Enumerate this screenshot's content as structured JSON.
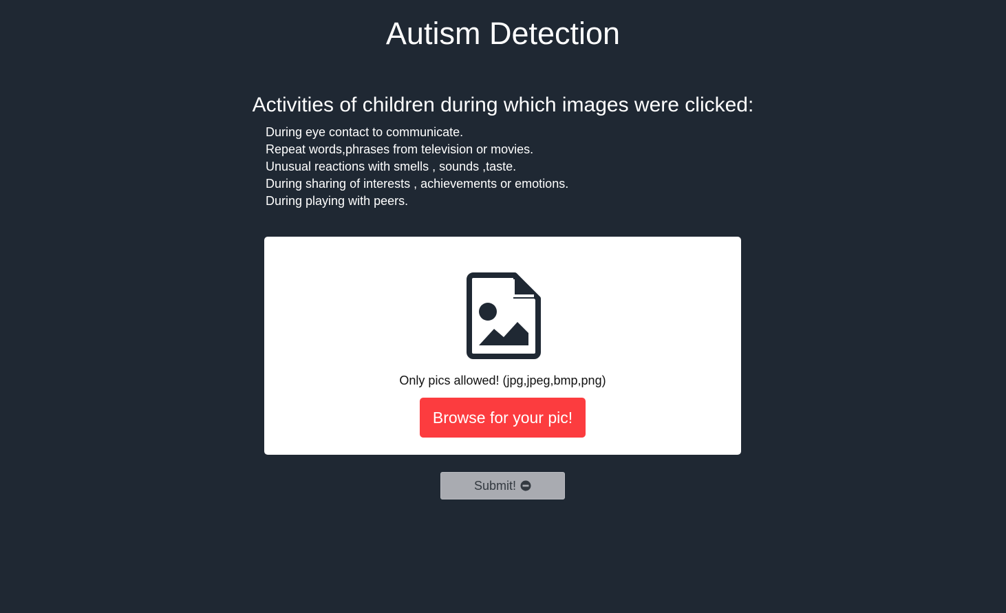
{
  "header": {
    "title": "Autism Detection"
  },
  "activities": {
    "heading": "Activities of children during which images were clicked:",
    "items": [
      "During eye contact to communicate.",
      "Repeat words,phrases from television or movies.",
      "Unusual reactions with smells , sounds ,taste.",
      "During sharing of interests , achievements or emotions.",
      "During playing with peers."
    ]
  },
  "upload": {
    "icon": "file-image-icon",
    "note": "Only pics allowed! (jpg,jpeg,bmp,png)",
    "browse_label": "Browse for your pic!"
  },
  "submit": {
    "label": "Submit!",
    "icon": "minus-circle-icon",
    "disabled": true
  },
  "colors": {
    "background": "#1f2833",
    "card": "#ffffff",
    "browse_button": "#fc3c3f",
    "submit_button": "#a9abb1",
    "icon": "#1f2833"
  }
}
